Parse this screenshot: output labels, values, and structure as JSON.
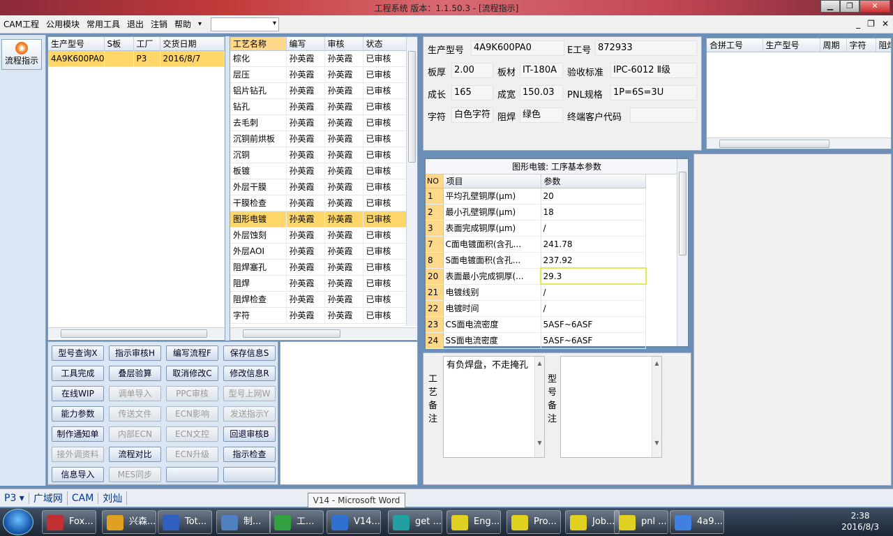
{
  "window": {
    "title": "工程系统  版本：1.1.50.3 - [流程指示]"
  },
  "menu": {
    "items": [
      "CAM工程",
      "公用模块",
      "常用工具",
      "退出",
      "注销",
      "帮助",
      "▾"
    ],
    "combo_value": ""
  },
  "left_nav": {
    "flow_button": "流程指示"
  },
  "orders": {
    "columns": [
      "生产型号",
      "S板",
      "工厂",
      "交货日期"
    ],
    "rows": [
      {
        "model": "4A9K600PA0",
        "s": "",
        "factory": "P3",
        "date": "2016/8/7"
      }
    ]
  },
  "process": {
    "columns": [
      "工艺名称",
      "编写",
      "审核",
      "状态"
    ],
    "rows": [
      [
        "棕化",
        "孙英霞",
        "孙英霞",
        "已审核"
      ],
      [
        "层压",
        "孙英霞",
        "孙英霞",
        "已审核"
      ],
      [
        "铝片钻孔",
        "孙英霞",
        "孙英霞",
        "已审核"
      ],
      [
        "钻孔",
        "孙英霞",
        "孙英霞",
        "已审核"
      ],
      [
        "去毛刺",
        "孙英霞",
        "孙英霞",
        "已审核"
      ],
      [
        "沉铜前烘板",
        "孙英霞",
        "孙英霞",
        "已审核"
      ],
      [
        "沉铜",
        "孙英霞",
        "孙英霞",
        "已审核"
      ],
      [
        "板镀",
        "孙英霞",
        "孙英霞",
        "已审核"
      ],
      [
        "外层干膜",
        "孙英霞",
        "孙英霞",
        "已审核"
      ],
      [
        "干膜检查",
        "孙英霞",
        "孙英霞",
        "已审核"
      ],
      [
        "图形电镀",
        "孙英霞",
        "孙英霞",
        "已审核"
      ],
      [
        "外层蚀刻",
        "孙英霞",
        "孙英霞",
        "已审核"
      ],
      [
        "外层AOI",
        "孙英霞",
        "孙英霞",
        "已审核"
      ],
      [
        "阻焊塞孔",
        "孙英霞",
        "孙英霞",
        "已审核"
      ],
      [
        "阻焊",
        "孙英霞",
        "孙英霞",
        "已审核"
      ],
      [
        "阻焊检查",
        "孙英霞",
        "孙英霞",
        "已审核"
      ],
      [
        "字符",
        "孙英霞",
        "孙英霞",
        "已审核"
      ]
    ],
    "selected_index": 10
  },
  "buttons": [
    [
      "型号查询X",
      "指示审核H",
      "编写流程F",
      "保存信息S"
    ],
    [
      "工具完成",
      "叠层验算",
      "取消修改C",
      "修改信息R"
    ],
    [
      "在线WIP",
      "调单导入",
      "PPC审核",
      "型号上网W"
    ],
    [
      "能力参数",
      "传送文件",
      "ECN影响",
      "发送指示Y"
    ],
    [
      "制作通知单",
      "内部ECN",
      "ECN文控",
      "回退审核B"
    ],
    [
      "接外调资料",
      "流程对比",
      "ECN升级",
      "指示检查"
    ],
    [
      "信息导入",
      "MES同步",
      "",
      ""
    ]
  ],
  "buttons_disabled": [
    [
      false,
      false,
      false,
      false
    ],
    [
      false,
      false,
      false,
      false
    ],
    [
      false,
      true,
      true,
      true
    ],
    [
      false,
      true,
      true,
      true
    ],
    [
      false,
      true,
      true,
      false
    ],
    [
      true,
      false,
      true,
      false
    ],
    [
      false,
      true,
      false,
      false
    ]
  ],
  "info": {
    "model_label": "生产型号",
    "model": "4A9K600PA0",
    "eno_label": "E工号",
    "eno": "872933",
    "thick_label": "板厚",
    "thick": "2.00",
    "mat_label": "板材",
    "mat": "IT-180A",
    "std_label": "验收标准",
    "std": "IPC-6012 Ⅱ级",
    "len_label": "成长",
    "len": "165",
    "wid_label": "成宽",
    "wid": "150.03",
    "pnl_label": "PNL规格",
    "pnl": "1P=6S=3U",
    "char_label": "字符",
    "char": "白色字符",
    "mask_label": "阻焊",
    "mask": "绿色",
    "cust_label": "终端客户代码",
    "cust": ""
  },
  "merge": {
    "columns": [
      "合拼工号",
      "生产型号",
      "周期",
      "字符",
      "阻焊"
    ]
  },
  "params": {
    "caption": "图形电镀: 工序基本参数",
    "columns": [
      "NO",
      "项目",
      "参数"
    ],
    "rows": [
      [
        "1",
        "平均孔壁铜厚(μm)",
        "20"
      ],
      [
        "2",
        "最小孔壁铜厚(μm)",
        "18"
      ],
      [
        "3",
        "表面完成铜厚(μm)",
        "/"
      ],
      [
        "7",
        "C面电镀面积(含孔...",
        "241.78"
      ],
      [
        "8",
        "S面电镀面积(含孔...",
        "237.92"
      ],
      [
        "20",
        "表面最小完成铜厚(...",
        "29.3"
      ],
      [
        "21",
        "电镀线别",
        "/"
      ],
      [
        "22",
        "电镀时间",
        "/"
      ],
      [
        "23",
        "CS面电流密度",
        "5ASF~6ASF"
      ],
      [
        "24",
        "SS面电流密度",
        "5ASF~6ASF"
      ]
    ]
  },
  "remarks": {
    "process_label": "工艺备注",
    "process_text": "有负焊盘，不走掩孔",
    "model_label": "型号备注",
    "model_text": ""
  },
  "status": {
    "items": [
      "P3",
      "广域网",
      "CAM",
      "刘灿"
    ],
    "tooltip": "V14 - Microsoft Word"
  },
  "taskbar": {
    "items": [
      "Fox...",
      "兴森...",
      "Tot...",
      "制...",
      "工...",
      "V14...",
      "get ...",
      "Eng...",
      "Pro...",
      "Job...",
      "pnl ...",
      "4a9..."
    ],
    "time": "2:38",
    "date": "2016/8/3"
  }
}
